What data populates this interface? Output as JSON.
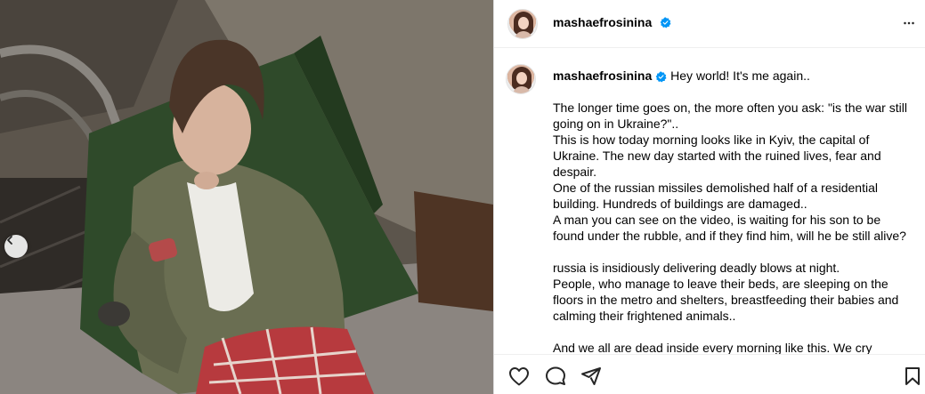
{
  "post": {
    "username": "mashaefrosinina",
    "verified": true,
    "caption_first_line": "Hey world! It's me again..",
    "caption_lines": [
      "",
      "The longer time goes on, the more often you ask: \"is the war still going on in Ukraine?\"..",
      "This is how today morning looks like in Kyiv, the capital of Ukraine. The new day started with the ruined lives, fear and despair.",
      "One of the russian missiles demolished half of a residential building. Hundreds of buildings are damaged..",
      "A man you can see on the video, is waiting for his son to be found under the rubble, and if they find him, will he be still alive?",
      "",
      "russia is insidiously delivering deadly blows at night.",
      "People, who manage to leave their beds, are sleeping on the floors in the metro and shelters, breastfeeding their babies and calming their frightened animals..",
      "",
      "And we all are dead inside every morning like this. We cry"
    ]
  },
  "icons": {
    "verified": "verified-badge-icon",
    "more": "more-options-icon",
    "prev": "chevron-left-icon",
    "like": "heart-icon",
    "comment": "comment-icon",
    "share": "share-icon",
    "save": "bookmark-icon"
  },
  "colors": {
    "verified_blue": "#0095f6",
    "border": "#dbdbdb"
  }
}
